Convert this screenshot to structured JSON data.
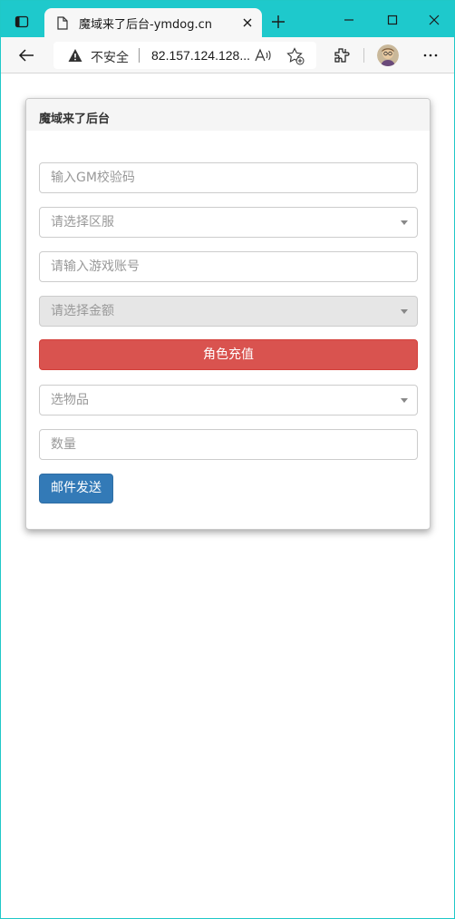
{
  "browser": {
    "tab_title": "魔域来了后台-ymdog.cn",
    "insecure_label": "不安全",
    "url": "82.157.124.128..."
  },
  "panel": {
    "heading": "魔域来了后台",
    "gm_code_placeholder": "输入GM校验码",
    "server_select": "请选择区服",
    "account_placeholder": "请输入游戏账号",
    "amount_select": "请选择金额",
    "recharge_button": "角色充值",
    "item_select": "选物品",
    "quantity_placeholder": "数量",
    "mail_button": "邮件发送"
  },
  "colors": {
    "tabstrip": "#1ec9cc",
    "danger": "#d9534f",
    "primary": "#337ab7"
  }
}
